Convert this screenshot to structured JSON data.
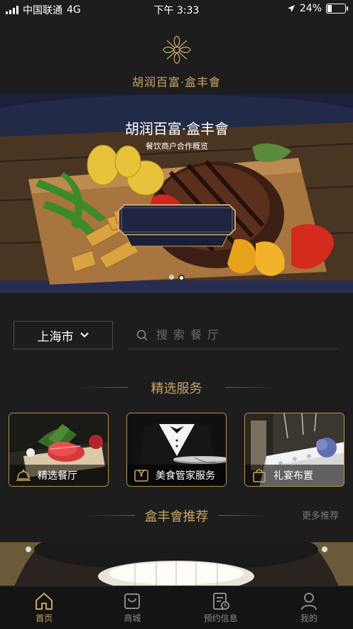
{
  "status_bar": {
    "carrier": "中国联通",
    "network": "4G",
    "time": "下午 3:33",
    "battery": "24%",
    "battery_level": 0.24
  },
  "brand": {
    "name": "胡润百富·盒丰會"
  },
  "banner": {
    "title": "胡润百富·盒丰會",
    "subtitle": "餐饮商户合作概览",
    "slide_count": 2,
    "active_slide": 2
  },
  "search": {
    "city": "上海市",
    "placeholder": "搜索餐厅"
  },
  "services": {
    "title": "精选服务",
    "items": [
      {
        "label": "精选餐厅",
        "icon": "cloche-icon"
      },
      {
        "label": "美食管家服务",
        "icon": "butler-icon"
      },
      {
        "label": "礼宴布置",
        "icon": "gift-bag-icon"
      }
    ]
  },
  "recommend": {
    "title": "盒丰會推荐",
    "more": "更多推荐"
  },
  "tabbar": {
    "items": [
      {
        "label": "首页",
        "icon": "home-icon",
        "active": true
      },
      {
        "label": "商城",
        "icon": "shopping-bag-icon",
        "active": false
      },
      {
        "label": "预约信息",
        "icon": "booking-icon",
        "active": false
      },
      {
        "label": "我的",
        "icon": "profile-icon",
        "active": false
      }
    ]
  },
  "colors": {
    "accent_gold": "#c7a665",
    "background": "#1d1d1d",
    "tabbar_bg": "#141414"
  }
}
